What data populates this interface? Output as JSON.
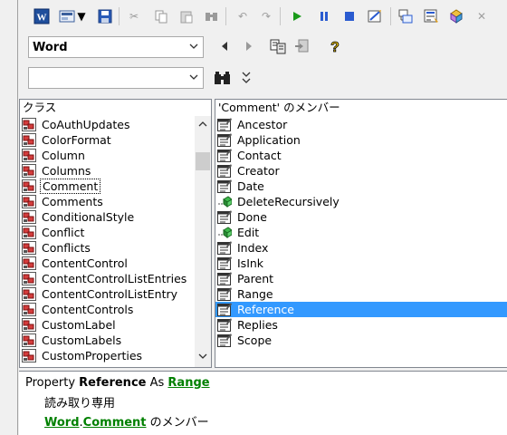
{
  "toolbar": {
    "icons": [
      "view-word-icon",
      "view-object-icon",
      "insert-dropdown-icon",
      "save-icon",
      "cut-icon",
      "copy-icon",
      "paste-icon",
      "find-icon",
      "undo-icon",
      "redo-icon",
      "run-icon",
      "break-icon",
      "reset-icon",
      "design-mode-icon",
      "project-explorer-icon",
      "properties-icon",
      "object-browser-icon",
      "toolbox-icon"
    ]
  },
  "library_select": {
    "value": "Word"
  },
  "search_combo": {
    "value": ""
  },
  "classes_pane": {
    "header": "クラス",
    "items": [
      "CoAuthUpdates",
      "ColorFormat",
      "Column",
      "Columns",
      "Comment",
      "Comments",
      "ConditionalStyle",
      "Conflict",
      "Conflicts",
      "ContentControl",
      "ContentControlListEntries",
      "ContentControlListEntry",
      "ContentControls",
      "CustomLabel",
      "CustomLabels",
      "CustomProperties"
    ],
    "selected_index": 4
  },
  "members_pane": {
    "header": "'Comment' のメンバー",
    "items": [
      {
        "name": "Ancestor",
        "kind": "property"
      },
      {
        "name": "Application",
        "kind": "property"
      },
      {
        "name": "Contact",
        "kind": "property"
      },
      {
        "name": "Creator",
        "kind": "property"
      },
      {
        "name": "Date",
        "kind": "property"
      },
      {
        "name": "DeleteRecursively",
        "kind": "method"
      },
      {
        "name": "Done",
        "kind": "property"
      },
      {
        "name": "Edit",
        "kind": "method"
      },
      {
        "name": "Index",
        "kind": "property"
      },
      {
        "name": "IsInk",
        "kind": "property"
      },
      {
        "name": "Parent",
        "kind": "property"
      },
      {
        "name": "Range",
        "kind": "property"
      },
      {
        "name": "Reference",
        "kind": "property"
      },
      {
        "name": "Replies",
        "kind": "property"
      },
      {
        "name": "Scope",
        "kind": "property"
      }
    ],
    "highlighted_index": 12
  },
  "details": {
    "prefix": "Property",
    "member": "Reference",
    "as_word": "As",
    "type_link": "Range",
    "readonly": "読み取り専用",
    "library_link": "Word",
    "dot": ".",
    "class_link": "Comment",
    "member_of": "のメンバー"
  },
  "colors": {
    "highlight": "#3399ff",
    "link": "#008000"
  }
}
